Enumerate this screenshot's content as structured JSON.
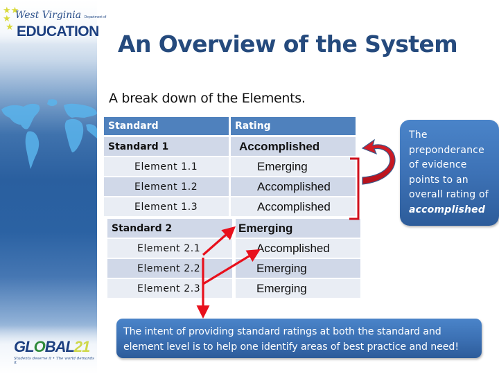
{
  "logos": {
    "top": {
      "script_text": "West Virginia",
      "small_text": "Department of",
      "main_text": "EDUCATION",
      "stars_icon": "stars-icon"
    },
    "bottom": {
      "main_text_a": "GL",
      "main_text_globe": "O",
      "main_text_b": "BAL",
      "main_text_num": "21",
      "tagline": "Students deserve it • The world demands it"
    }
  },
  "title": "An Overview of the System",
  "subtitle": "A break down of the Elements.",
  "table": {
    "headers": [
      "Standard",
      "Rating"
    ],
    "rows": [
      {
        "type": "standard",
        "label": "Standard 1",
        "rating": "Accomplished"
      },
      {
        "type": "element",
        "label": "Element  1.1",
        "rating": "Emerging"
      },
      {
        "type": "element",
        "label": "Element  1.2",
        "rating": "Accomplished"
      },
      {
        "type": "element",
        "label": "Element  1.3",
        "rating": "Accomplished"
      },
      {
        "type": "standard",
        "label": "Standard 2",
        "rating": "Emerging"
      },
      {
        "type": "element",
        "label": "Element  2.1",
        "rating": "Accomplished"
      },
      {
        "type": "element",
        "label": "Element  2.2",
        "rating": "Emerging"
      },
      {
        "type": "element",
        "label": "Element  2.3",
        "rating": "Emerging"
      }
    ]
  },
  "callouts": {
    "right": {
      "lines": [
        "The",
        "preponderance",
        "of evidence",
        "points to an",
        "overall rating of"
      ],
      "emphasis": "accomplished"
    },
    "bottom": {
      "lines": [
        "The intent of providing standard ratings at both the standard and",
        "element level is to help one identify areas of best practice and need!"
      ]
    }
  },
  "colors": {
    "title": "#254a7d",
    "table_header": "#4f81bd",
    "row_shade_dark": "#d0d8e8",
    "row_shade_light": "#e9edf4",
    "callout": "#3d72b6",
    "arrow": "#e8101c"
  }
}
